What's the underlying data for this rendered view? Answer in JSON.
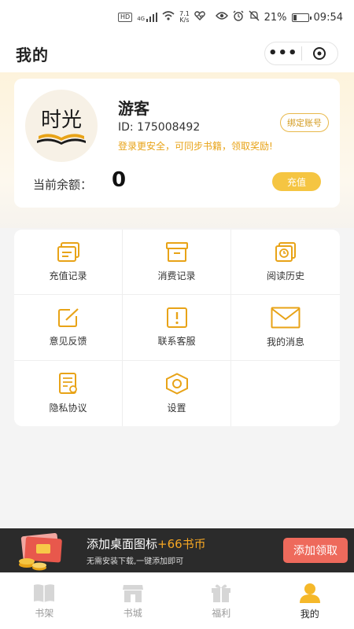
{
  "status": {
    "network_tag": "HD",
    "signal": "4G",
    "speed_value": "7.1",
    "speed_unit": "K/s",
    "battery": "21%",
    "battery_level": 0.21,
    "time": "09:54"
  },
  "header": {
    "title": "我的"
  },
  "profile": {
    "name": "游客",
    "id_text": "ID: 175008492",
    "tip": "登录更安全，可同步书籍，领取奖励!",
    "bind_label": "绑定账号",
    "balance_label": "当前余额：",
    "balance_value": "0",
    "recharge_label": "充值",
    "logo_text": "时光"
  },
  "menu": [
    {
      "label": "充值记录",
      "icon": "recharge-record-icon"
    },
    {
      "label": "消费记录",
      "icon": "consume-record-icon"
    },
    {
      "label": "阅读历史",
      "icon": "reading-history-icon"
    },
    {
      "label": "意见反馈",
      "icon": "feedback-icon"
    },
    {
      "label": "联系客服",
      "icon": "customer-service-icon"
    },
    {
      "label": "我的消息",
      "icon": "message-icon"
    },
    {
      "label": "隐私协议",
      "icon": "privacy-icon"
    },
    {
      "label": "设置",
      "icon": "settings-icon"
    }
  ],
  "promo": {
    "title": "添加桌面图标",
    "reward": "+66书币",
    "subtitle": "无需安装下载,一键添加即可",
    "button": "添加领取"
  },
  "tabs": [
    {
      "label": "书架",
      "icon": "bookshelf-icon",
      "active": false
    },
    {
      "label": "书城",
      "icon": "bookstore-icon",
      "active": false
    },
    {
      "label": "福利",
      "icon": "gift-icon",
      "active": false
    },
    {
      "label": "我的",
      "icon": "profile-icon",
      "active": true
    }
  ],
  "colors": {
    "accent": "#f5c542",
    "icon_gold": "#e8a317",
    "promo_button": "#ee6a5c",
    "tab_inactive": "#d6d6d6"
  }
}
